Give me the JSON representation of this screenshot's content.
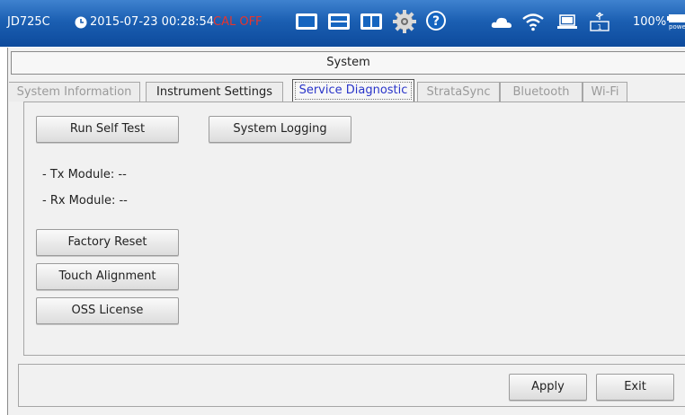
{
  "status_bar": {
    "model": "JD725C",
    "datetime": "2015-07-23 00:28:54",
    "cal_status": "CAL OFF",
    "battery": "100%",
    "power_label": "power",
    "icons": [
      "single-view-icon",
      "dual-view-icon",
      "split-view-icon",
      "settings-gear-icon",
      "help-icon",
      "cloud-icon",
      "wifi-icon",
      "laptop-icon",
      "usb-icon",
      "battery-icon"
    ],
    "colors": {
      "bar": "#1b5fb2",
      "cal_off": "#e8342c"
    }
  },
  "window": {
    "title": "System"
  },
  "tabs": [
    {
      "label": "System Information",
      "state": "disabled"
    },
    {
      "label": "Instrument Settings",
      "state": "normal"
    },
    {
      "label": "Service Diagnostic",
      "state": "active"
    },
    {
      "label": "StrataSync",
      "state": "disabled"
    },
    {
      "label": "Bluetooth",
      "state": "disabled"
    },
    {
      "label": "Wi-Fi",
      "state": "disabled"
    }
  ],
  "service_diagnostic": {
    "run_self_test": "Run Self Test",
    "system_logging": "System Logging",
    "tx_module": "- Tx Module: --",
    "rx_module": "- Rx Module: --",
    "factory_reset": "Factory Reset",
    "touch_alignment": "Touch Alignment",
    "oss_license": "OSS License"
  },
  "footer": {
    "apply": "Apply",
    "exit": "Exit"
  }
}
